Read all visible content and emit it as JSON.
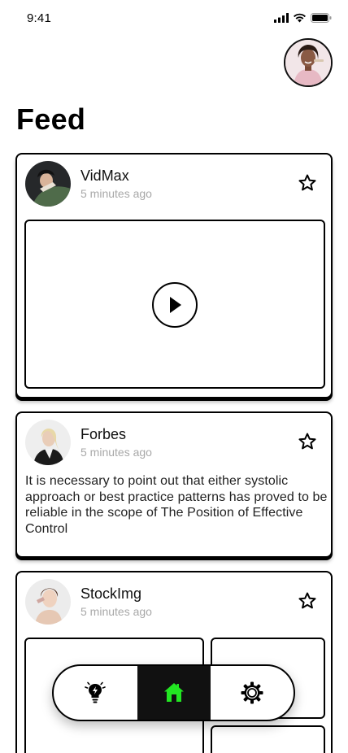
{
  "status_bar": {
    "time": "9:41"
  },
  "page": {
    "title": "Feed"
  },
  "posts": [
    {
      "author": "VidMax",
      "time": "5 minutes ago",
      "type": "video"
    },
    {
      "author": "Forbes",
      "time": "5 minutes ago",
      "type": "text",
      "text": "It is necessary to point out that either systolic approach or best practice patterns has proved to be reliable in the scope of The Position of Effective Control"
    },
    {
      "author": "StockImg",
      "time": "5 minutes ago",
      "type": "images"
    }
  ],
  "nav": {
    "items": [
      "lightbulb-icon",
      "home-icon",
      "settings-gear-icon"
    ],
    "active_item": "home-icon",
    "active_color": "#22e622"
  },
  "colors": {
    "background": "#ffffff",
    "border": "#000000",
    "muted_text": "#a8a8a8",
    "nav_active_bg": "#111111"
  }
}
